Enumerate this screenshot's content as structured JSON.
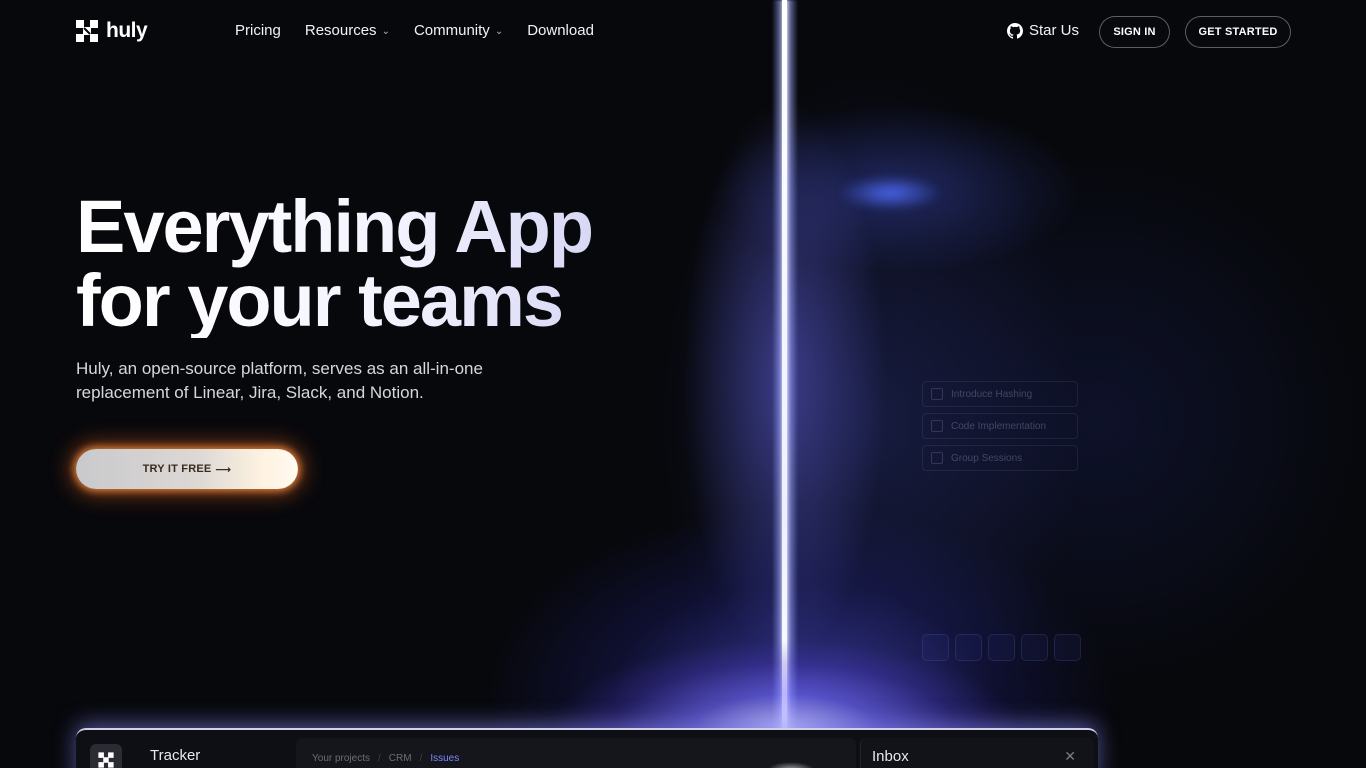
{
  "brand": {
    "name": "huly",
    "logo_icon": "huly-logo-icon"
  },
  "nav": {
    "items": [
      {
        "label": "Pricing",
        "has_dropdown": false
      },
      {
        "label": "Resources",
        "has_dropdown": true
      },
      {
        "label": "Community",
        "has_dropdown": true
      },
      {
        "label": "Download",
        "has_dropdown": false
      }
    ]
  },
  "header_actions": {
    "star_label": "Star Us",
    "star_icon": "github-icon",
    "signin_label": "SIGN IN",
    "get_started_label": "GET STARTED"
  },
  "hero": {
    "title_line1": "Everything App",
    "title_line2": "for your teams",
    "subtitle_line1": "Huly, an open-source platform, serves as an all-in-one",
    "subtitle_line2": "replacement of Linear, Jira, Slack, and Notion.",
    "cta_label": "TRY IT FREE",
    "cta_arrow": "⟶"
  },
  "preview": {
    "app_title": "Tracker",
    "breadcrumbs": [
      "Your projects",
      "CRM",
      "Issues"
    ],
    "inbox_title": "Inbox",
    "inbox_close": "✕"
  },
  "ghost_ui": {
    "rows": [
      "Introduce Hashing",
      "Code Implementation",
      "Group Sessions"
    ]
  },
  "colors": {
    "background": "#07080c",
    "beam": "#ffffff",
    "glow": "#5a5aff",
    "cta_glow": "#ff8a3d",
    "breadcrumb_active": "#7d86ff"
  }
}
